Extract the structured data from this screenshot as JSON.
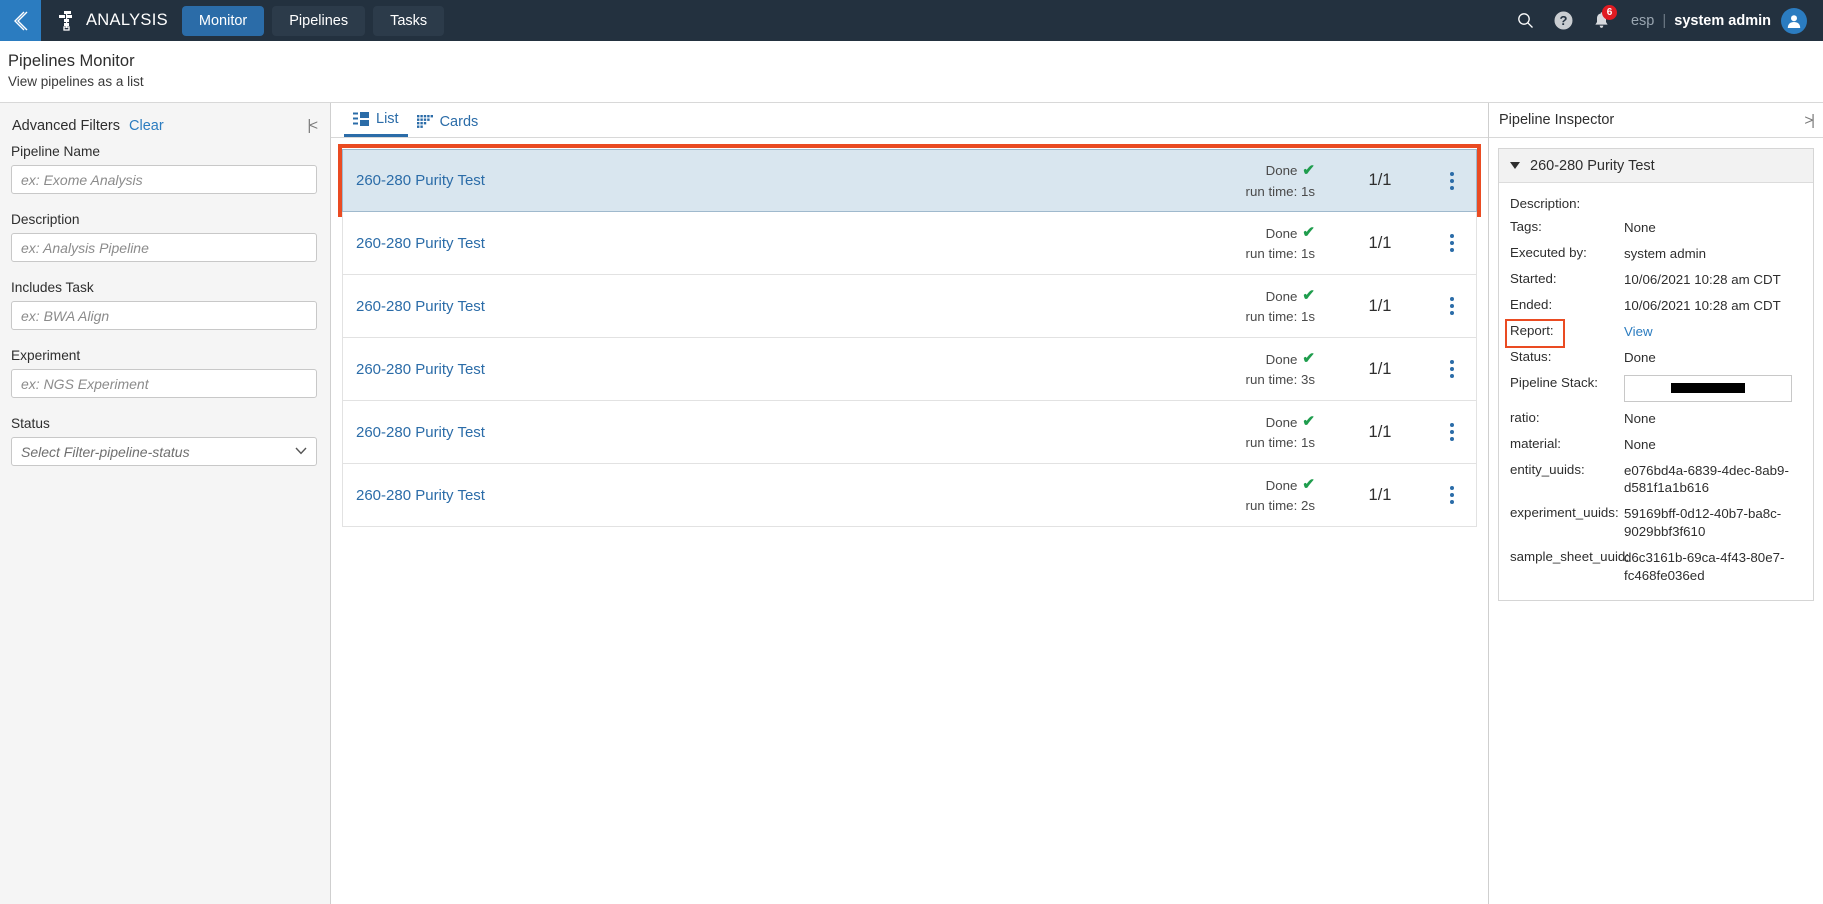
{
  "topbar": {
    "back_icon": "back-chevron-icon",
    "brand_logo_icon": "pipeline-logo-icon",
    "brand": "ANALYSIS",
    "tabs": [
      {
        "label": "Monitor",
        "active": true
      },
      {
        "label": "Pipelines",
        "active": false
      },
      {
        "label": "Tasks",
        "active": false
      }
    ],
    "search_icon": "search-icon",
    "help_icon": "help-circle-icon",
    "bell_icon": "bell-icon",
    "notification_count": "6",
    "locale": "esp",
    "separator": "|",
    "user_name": "system admin",
    "avatar_icon": "user-avatar-icon"
  },
  "page": {
    "title": "Pipelines Monitor",
    "subtitle": "View pipelines as a list"
  },
  "sidebar": {
    "heading": "Advanced Filters",
    "clear_label": "Clear",
    "collapse_icon": "collapse-left-icon",
    "fields": [
      {
        "label": "Pipeline Name",
        "placeholder": "ex: Exome Analysis",
        "value": "",
        "type": "text",
        "name": "pipeline-name-input"
      },
      {
        "label": "Description",
        "placeholder": "ex: Analysis Pipeline",
        "value": "",
        "type": "text",
        "name": "description-input"
      },
      {
        "label": "Includes Task",
        "placeholder": "ex: BWA Align",
        "value": "",
        "type": "text",
        "name": "includes-task-input"
      },
      {
        "label": "Experiment",
        "placeholder": "ex: NGS Experiment",
        "value": "",
        "type": "text",
        "name": "experiment-input"
      }
    ],
    "status_label": "Status",
    "status_selected": "Select Filter-pipeline-status"
  },
  "view_tabs": [
    {
      "label": "List",
      "icon": "list-view-icon",
      "active": true
    },
    {
      "label": "Cards",
      "icon": "cards-view-icon",
      "active": false
    }
  ],
  "list": {
    "rows": [
      {
        "name": "260-280 Purity Test",
        "status": "Done",
        "run_time": "run time: 1s",
        "count": "1/1",
        "selected": true
      },
      {
        "name": "260-280 Purity Test",
        "status": "Done",
        "run_time": "run time: 1s",
        "count": "1/1",
        "selected": false
      },
      {
        "name": "260-280 Purity Test",
        "status": "Done",
        "run_time": "run time: 1s",
        "count": "1/1",
        "selected": false
      },
      {
        "name": "260-280 Purity Test",
        "status": "Done",
        "run_time": "run time: 3s",
        "count": "1/1",
        "selected": false
      },
      {
        "name": "260-280 Purity Test",
        "status": "Done",
        "run_time": "run time: 1s",
        "count": "1/1",
        "selected": false
      },
      {
        "name": "260-280 Purity Test",
        "status": "Done",
        "run_time": "run time: 2s",
        "count": "1/1",
        "selected": false
      }
    ],
    "check_glyph": "✔",
    "kebab_icon": "kebab-menu-icon"
  },
  "inspector": {
    "title": "Pipeline Inspector",
    "collapse_icon": "collapse-right-icon",
    "card_title": "260-280 Purity Test",
    "caret_icon": "caret-down-icon",
    "details": [
      {
        "key": "Description:",
        "value": ""
      },
      {
        "key": "Tags:",
        "value": "None"
      },
      {
        "key": "Executed by:",
        "value": "system admin"
      },
      {
        "key": "Started:",
        "value": "10/06/2021 10:28 am CDT"
      },
      {
        "key": "Ended:",
        "value": "10/06/2021 10:28 am CDT"
      },
      {
        "key": "Report:",
        "value": "View",
        "link": true,
        "highlight": true
      },
      {
        "key": "Status:",
        "value": "Done"
      },
      {
        "key": "Pipeline Stack:",
        "value": "",
        "redacted": true
      },
      {
        "key": "ratio:",
        "value": "None"
      },
      {
        "key": "material:",
        "value": "None"
      },
      {
        "key": "entity_uuids:",
        "value": "e076bd4a-6839-4dec-8ab9-d581f1a1b616"
      },
      {
        "key": "experiment_uuids:",
        "value": "59169bff-0d12-40b7-ba8c-9029bbf3f610"
      },
      {
        "key": "sample_sheet_uuid:",
        "value": "d6c3161b-69ca-4f43-80e7-fc468fe036ed"
      }
    ]
  },
  "colors": {
    "topbar_bg": "#23313f",
    "accent_blue": "#2b6ca8",
    "link_blue": "#2b7cc0",
    "highlight_red": "#ea4b22",
    "selected_row_bg": "#d9e6ef",
    "success_green": "#1f9d4d",
    "badge_red": "#e01b22"
  }
}
